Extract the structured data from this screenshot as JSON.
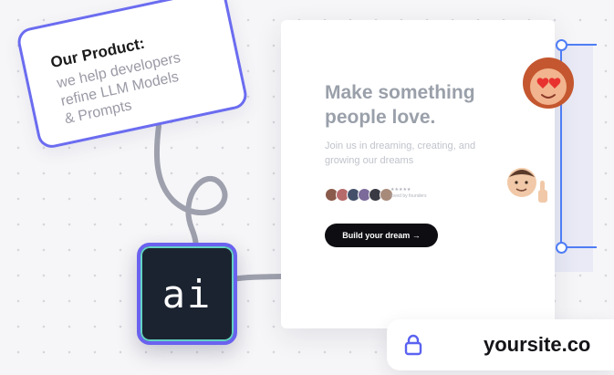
{
  "note": {
    "title": "Our Product:",
    "line1": "we help developers",
    "line2": "refine LLM Models",
    "line3": "& Prompts"
  },
  "card": {
    "headline_1": "Make something",
    "headline_2": "people love.",
    "subtext_1": "Join us in dreaming, creating, and",
    "subtext_2": "growing our dreams",
    "rating_1": "★★★★★",
    "rating_2": "loved by founders",
    "cta_label": "Build your dream →"
  },
  "ai_icon": {
    "label": "ai"
  },
  "urlbar": {
    "url": "yoursite.co"
  },
  "colors": {
    "note_border": "#6b6cf0",
    "selection_blue": "#4f7df5",
    "cta_bg": "#0d0d12",
    "ai_bg": "#1b2330"
  },
  "icons": [
    "lock-icon",
    "arrow-icon",
    "squiggle-icon",
    "heart-eyes-emoji",
    "thumbs-up-emoji"
  ]
}
